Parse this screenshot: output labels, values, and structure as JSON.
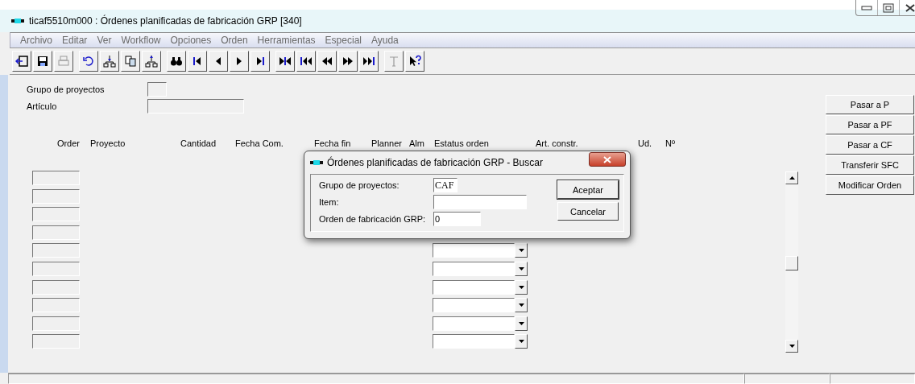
{
  "window": {
    "title": "ticaf5510m000 : Órdenes planificadas de fabricación GRP [340]"
  },
  "menu": [
    "Archivo",
    "Editar",
    "Ver",
    "Workflow",
    "Opciones",
    "Orden",
    "Herramientas",
    "Especial",
    "Ayuda"
  ],
  "toolbar": [
    [
      {
        "kind": "exit",
        "disabled": false
      },
      {
        "kind": "save",
        "disabled": false
      },
      {
        "kind": "print",
        "disabled": true
      }
    ],
    [
      {
        "kind": "undo",
        "disabled": false
      },
      {
        "kind": "tree-down",
        "disabled": false
      },
      {
        "kind": "copy",
        "disabled": false
      },
      {
        "kind": "tree-up",
        "disabled": false
      }
    ],
    [
      {
        "kind": "find",
        "disabled": false
      },
      {
        "kind": "first",
        "disabled": false
      },
      {
        "kind": "prev",
        "disabled": false
      },
      {
        "kind": "next",
        "disabled": false
      },
      {
        "kind": "last",
        "disabled": false
      }
    ],
    [
      {
        "kind": "mid",
        "disabled": false
      },
      {
        "kind": "first-set",
        "disabled": false
      },
      {
        "kind": "prev-set",
        "disabled": false
      },
      {
        "kind": "next-set",
        "disabled": false
      },
      {
        "kind": "last-set",
        "disabled": false
      }
    ],
    [
      {
        "kind": "text",
        "disabled": true
      },
      {
        "kind": "help",
        "disabled": false
      }
    ]
  ],
  "form": {
    "fields": [
      {
        "label": "Grupo de proyectos",
        "kind": "short"
      },
      {
        "label": "Artículo",
        "kind": "long"
      }
    ]
  },
  "table": {
    "columns": [
      "Order",
      "Proyecto",
      "Cantidad",
      "Fecha Com.",
      "Fecha fin",
      "Planner",
      "Alm",
      "Estatus orden",
      "Art. constr.",
      "Ud.",
      "Nº"
    ],
    "rows": [
      {
        "kind": "order-only"
      },
      {
        "kind": "order-only"
      },
      {
        "kind": "order-only"
      },
      {
        "kind": "order-only"
      },
      {
        "kind": "order-status"
      },
      {
        "kind": "order-status"
      },
      {
        "kind": "order-status"
      },
      {
        "kind": "order-status"
      },
      {
        "kind": "order-status"
      },
      {
        "kind": "order-status"
      }
    ]
  },
  "actions": [
    "Pasar a P",
    "Pasar a PF",
    "Pasar a CF",
    "Transferir SFC",
    "Modificar Orden"
  ],
  "dialog": {
    "title": "Órdenes planificadas de fabricación GRP - Buscar",
    "fields": [
      {
        "label": "Grupo de proyectos:",
        "value": "CAF",
        "kind": "code"
      },
      {
        "label": "Item:",
        "kind": "long"
      },
      {
        "label": "Orden de fabricación GRP:",
        "value": "0",
        "kind": "medium"
      }
    ],
    "buttons": [
      "Aceptar",
      "Cancelar"
    ]
  },
  "status_bar": {
    "panels": [
      {
        "kind": "main"
      },
      {
        "kind": "small"
      },
      {
        "kind": "small"
      }
    ]
  }
}
